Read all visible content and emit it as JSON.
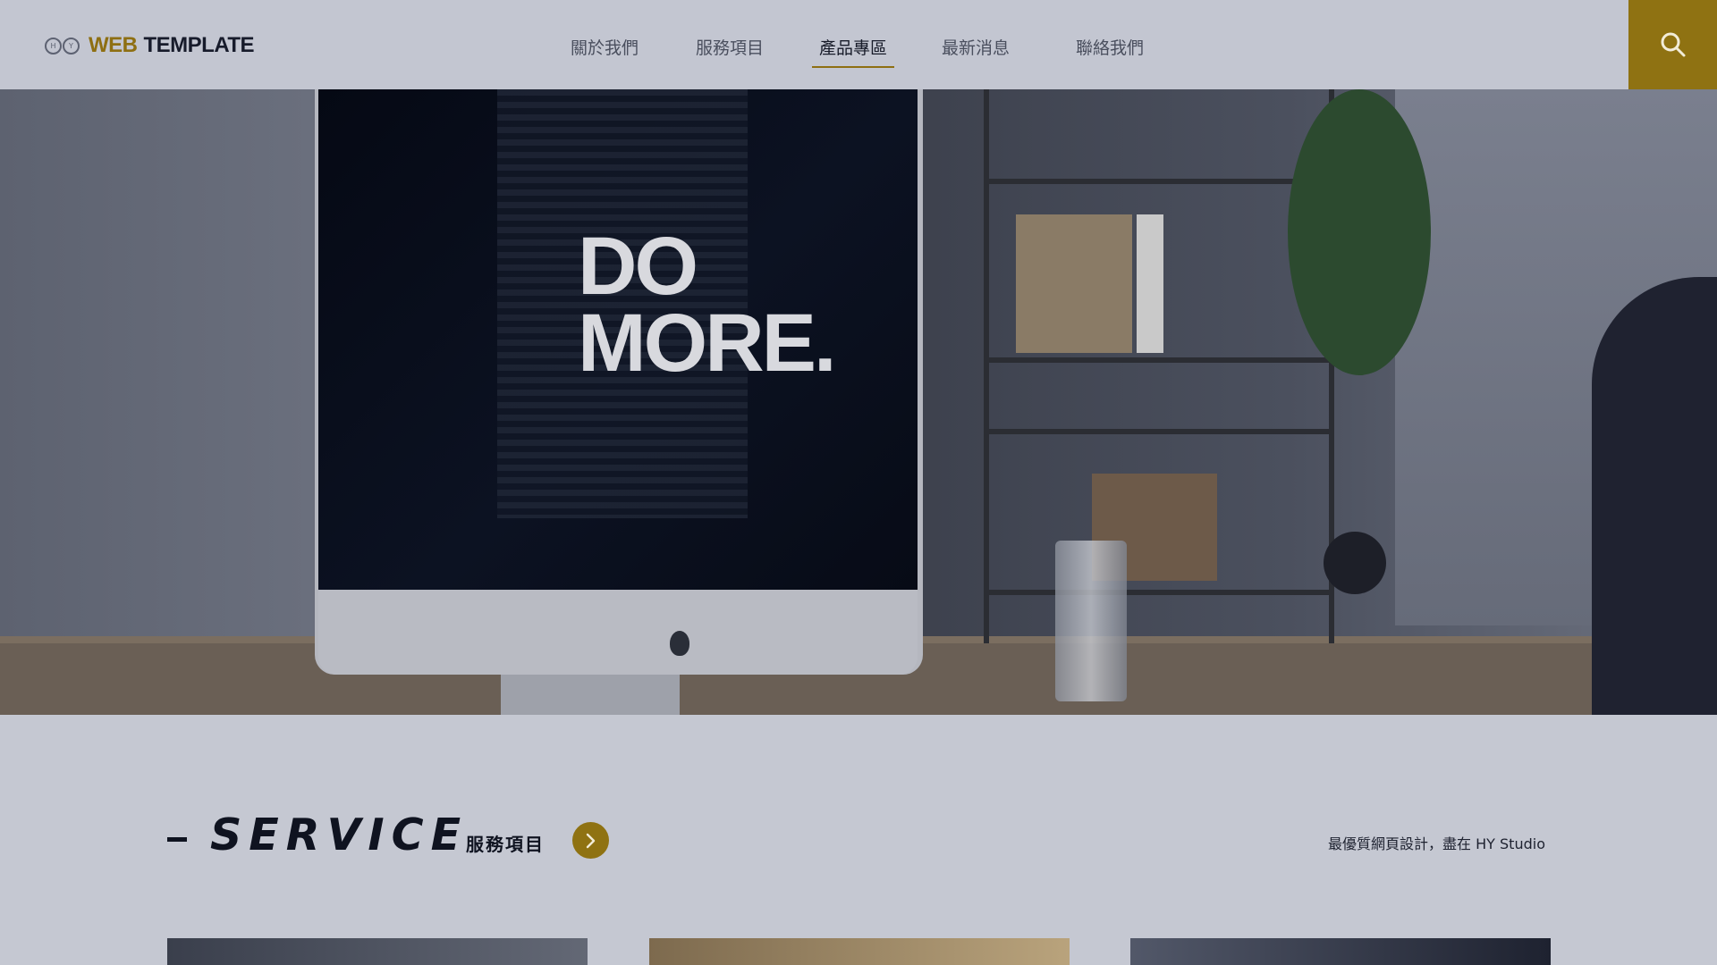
{
  "header": {
    "logo_mark_letters": [
      "H",
      "Y"
    ],
    "logo_web": "WEB",
    "logo_template": "TEMPLATE",
    "nav": [
      {
        "label": "關於我們",
        "active": false
      },
      {
        "label": "服務項目",
        "active": false
      },
      {
        "label": "產品專區",
        "active": true
      },
      {
        "label": "最新消息",
        "active": false
      },
      {
        "label": "聯絡我們",
        "active": false
      }
    ],
    "search_icon": "search-icon"
  },
  "hero": {
    "screen_line_1": "DO",
    "screen_line_2": "MORE.",
    "slide_count": 3,
    "active_slide": 1
  },
  "service": {
    "title": "SERVICE",
    "subtitle": "服務項目",
    "tagline": "最優質網頁設計，盡在 HY Studio",
    "more_icon": "chevron-right-icon"
  },
  "colors": {
    "accent": "#8f7212",
    "dark": "#0f1320",
    "header_bg": "#c3c6d1"
  }
}
